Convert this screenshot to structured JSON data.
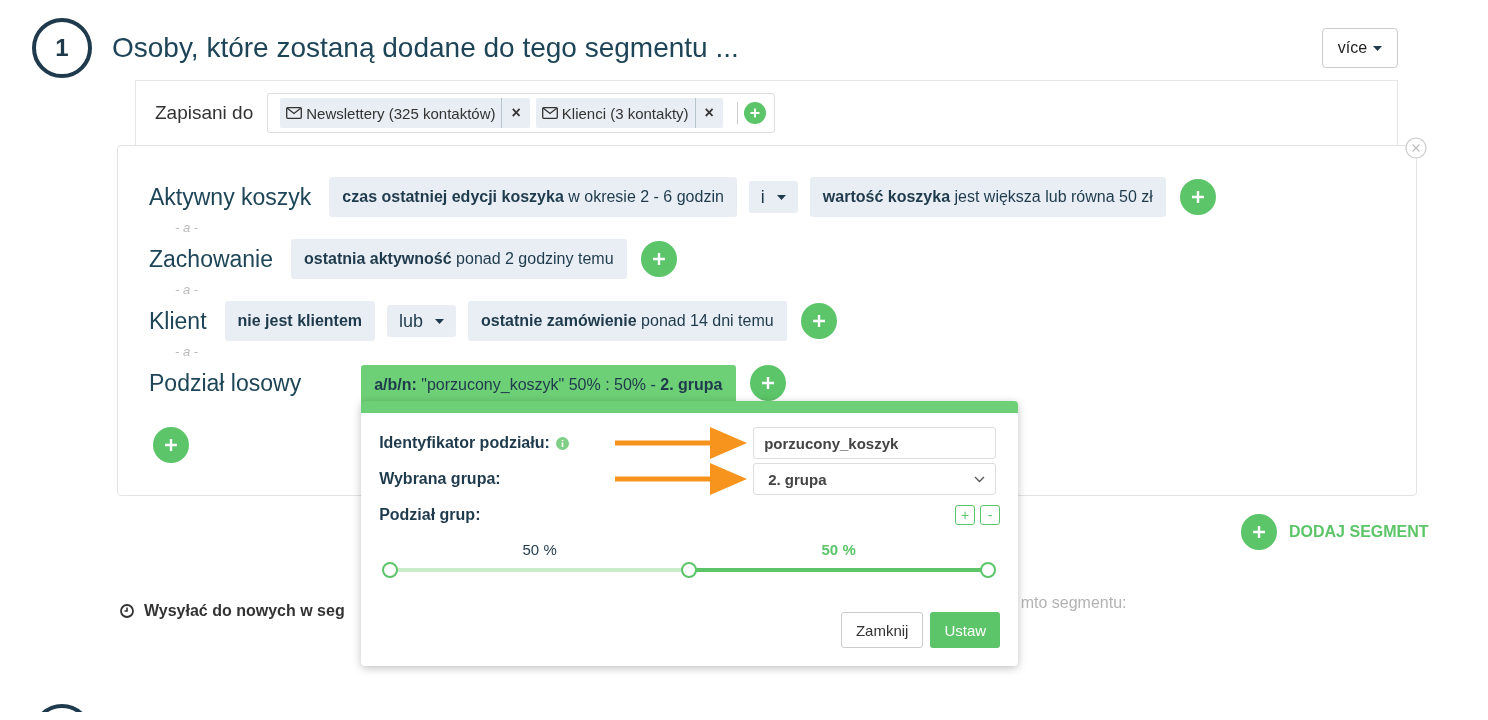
{
  "step": {
    "number": "1",
    "title": "Osoby, które zostaną dodane do tego segmentu ..."
  },
  "more_button": "více",
  "subscribed": {
    "label": "Zapisani do",
    "lists": [
      {
        "name": "Newslettery (325 kontaktów)",
        "remove": "×"
      },
      {
        "name": "Klienci (3 kontakty)",
        "remove": "×"
      }
    ]
  },
  "conditions": [
    {
      "label": "Aktywny koszyk",
      "items": [
        {
          "kind": "filter",
          "text": "**czas ostatniej edycji koszyka** w okresie 2 - 6 godzin",
          "selected": false
        },
        {
          "kind": "operator",
          "text": "i"
        },
        {
          "kind": "filter",
          "text": "**wartość koszyka** jest większa lub równa 50 zł",
          "selected": false
        }
      ]
    },
    {
      "joiner": "- a -",
      "label": "Zachowanie",
      "items": [
        {
          "kind": "filter",
          "text": "**ostatnia aktywność** ponad 2 godziny temu",
          "selected": false
        }
      ]
    },
    {
      "joiner": "- a -",
      "label": "Klient",
      "items": [
        {
          "kind": "filter",
          "text": "**nie jest klientem**",
          "selected": false
        },
        {
          "kind": "operator",
          "text": "lub"
        },
        {
          "kind": "filter",
          "text": "**ostatnie zamówienie** ponad 14 dni temu",
          "selected": false
        }
      ]
    },
    {
      "joiner": "- a -",
      "label": "Podział losowy",
      "items": [
        {
          "kind": "filter",
          "text": "**a/b/n:** \"porzucony_koszyk\" 50% : 50% - **2. grupa**",
          "selected": true
        }
      ]
    }
  ],
  "popover": {
    "fields": [
      {
        "kind": "text",
        "label": "Identyfikator podziału:",
        "info": true,
        "value": "porzucony_koszyk"
      },
      {
        "kind": "select",
        "label": "Wybrana grupa:",
        "info": false,
        "value": "2. grupa"
      }
    ],
    "groups_label": "Podział grup:",
    "add": "+",
    "remove": "-",
    "groups": [
      {
        "label": "50 %",
        "selected": false
      },
      {
        "label": "50 %",
        "selected": true
      }
    ],
    "split": {
      "level": 0.5
    },
    "close": "Zamknij",
    "apply": "Ustaw"
  },
  "add_segment": "DODAJ SEGMENT",
  "send_new": "Wysyłać do nowych w seg",
  "send_new_tail": "mto segmentu:"
}
